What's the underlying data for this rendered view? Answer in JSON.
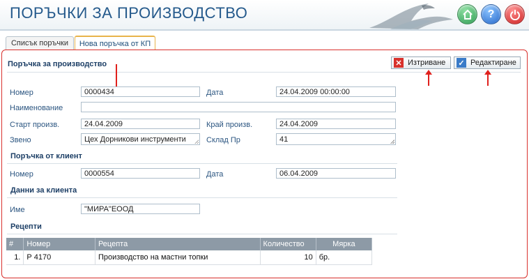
{
  "header": {
    "title": "ПОРЪЧКИ ЗА ПРОИЗВОДСТВО"
  },
  "tabs": [
    {
      "label": "Списък поръчки"
    },
    {
      "label": "Нова поръчка от КП"
    }
  ],
  "actions": {
    "delete_label": "Изтриване",
    "edit_label": "Редактиране"
  },
  "order": {
    "section_title": "Поръчка за производство",
    "number_label": "Номер",
    "number_value": "0000434",
    "date_label": "Дата",
    "date_value": "24.04.2009 00:00:00",
    "name_label": "Наименование",
    "name_value": "",
    "start_label": "Старт произв.",
    "start_value": "24.04.2009",
    "end_label": "Край произв.",
    "end_value": "24.04.2009",
    "unit_label": "Звено",
    "unit_value": "Цех Дорникови инструменти",
    "warehouse_label": "Склад Пр",
    "warehouse_value": "41"
  },
  "client_order": {
    "section_title": "Поръчка от клиент",
    "number_label": "Номер",
    "number_value": "0000554",
    "date_label": "Дата",
    "date_value": "06.04.2009"
  },
  "client_data": {
    "section_title": "Данни за клиента",
    "name_label": "Име",
    "name_value": "\"МИРА\"ЕООД"
  },
  "recipes": {
    "section_title": "Рецепти",
    "columns": [
      "#",
      "Номер",
      "Рецепта",
      "Количество",
      "Мярка"
    ],
    "rows": [
      {
        "index": "1.",
        "number": "Р 4170",
        "recipe": "Производство на мастни топки",
        "quantity": "10",
        "unit": "бр."
      }
    ]
  },
  "colors": {
    "accent": "#255a8c",
    "panel_border": "#d9302c",
    "arrow": "#e0201c"
  }
}
